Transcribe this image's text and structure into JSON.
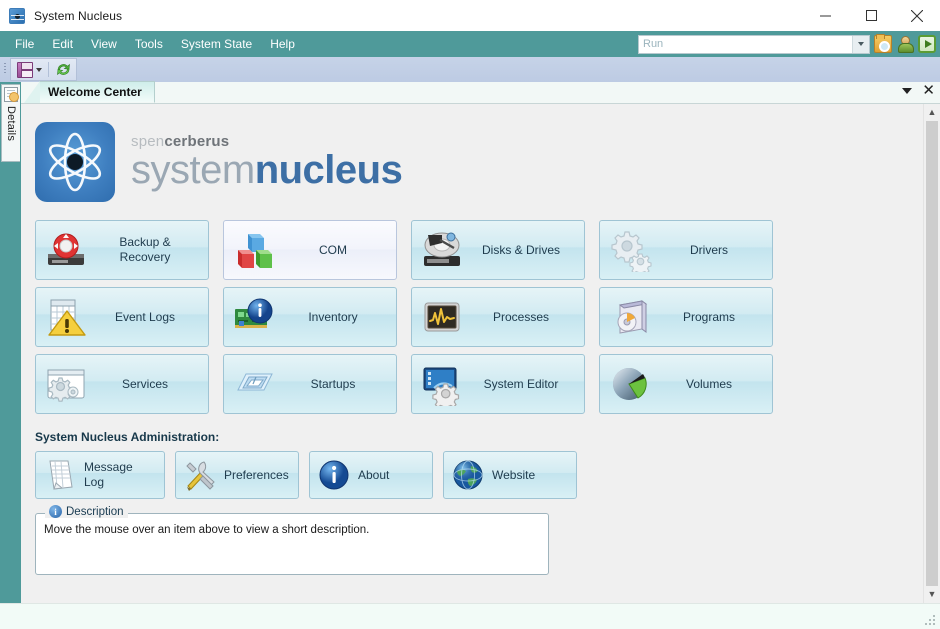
{
  "window": {
    "title": "System Nucleus",
    "app_icon": "atom-icon",
    "minimize_label": "Minimize",
    "maximize_label": "Maximize",
    "close_label": "Close"
  },
  "menubar": {
    "items": [
      {
        "label": "File"
      },
      {
        "label": "Edit"
      },
      {
        "label": "View"
      },
      {
        "label": "Tools"
      },
      {
        "label": "System State"
      },
      {
        "label": "Help"
      }
    ],
    "run_box": {
      "value": "",
      "placeholder": "Run"
    },
    "right_icons": [
      {
        "name": "folder-search-icon"
      },
      {
        "name": "user-icon"
      },
      {
        "name": "run-play-icon"
      }
    ]
  },
  "toolbar": {
    "save_label": "Save",
    "save_dropdown_label": "Save options",
    "refresh_label": "Refresh"
  },
  "side_dock": {
    "details_tab_label": "Details"
  },
  "tabstrip": {
    "tabs": [
      {
        "label": "Welcome Center",
        "active": true
      }
    ],
    "dropdown_label": "Tab list",
    "close_label": "Close tab"
  },
  "logo": {
    "line1_light": "spen",
    "line1_bold": "cerberus",
    "line2_light": "system",
    "line2_bold": "nucleus"
  },
  "tiles": [
    {
      "label": "Backup &\nRecovery",
      "icon": "backup-recovery-icon",
      "hover": false
    },
    {
      "label": "COM",
      "icon": "com-icon",
      "hover": true
    },
    {
      "label": "Disks & Drives",
      "icon": "disks-drives-icon",
      "hover": false
    },
    {
      "label": "Drivers",
      "icon": "drivers-icon",
      "hover": false
    },
    {
      "label": "Event Logs",
      "icon": "event-logs-icon",
      "hover": false
    },
    {
      "label": "Inventory",
      "icon": "inventory-icon",
      "hover": false
    },
    {
      "label": "Processes",
      "icon": "processes-icon",
      "hover": false
    },
    {
      "label": "Programs",
      "icon": "programs-icon",
      "hover": false
    },
    {
      "label": "Services",
      "icon": "services-icon",
      "hover": false
    },
    {
      "label": "Startups",
      "icon": "startups-icon",
      "hover": false
    },
    {
      "label": "System Editor",
      "icon": "system-editor-icon",
      "hover": false
    },
    {
      "label": "Volumes",
      "icon": "volumes-icon",
      "hover": false
    }
  ],
  "admin": {
    "title": "System Nucleus Administration:",
    "buttons": [
      {
        "label": "Message\nLog",
        "icon": "message-log-icon"
      },
      {
        "label": "Preferences",
        "icon": "preferences-icon"
      },
      {
        "label": "About",
        "icon": "about-icon"
      },
      {
        "label": "Website",
        "icon": "website-icon"
      }
    ]
  },
  "description": {
    "legend": "Description",
    "text": "Move the mouse over an item above to view a short description."
  },
  "scrollbar": {
    "up_label": "Scroll up",
    "down_label": "Scroll down",
    "thumb_label": "Scroll thumb"
  },
  "colors": {
    "menubar": "#4f9a9a",
    "toolbar": "#c6d3e8",
    "tile_face": "#d2ebf2",
    "tile_border": "#9fc4d4",
    "brand_blue": "#3d6fa5",
    "panel_bg": "#f0f0f0",
    "statusbar": "#f2fbf7"
  }
}
